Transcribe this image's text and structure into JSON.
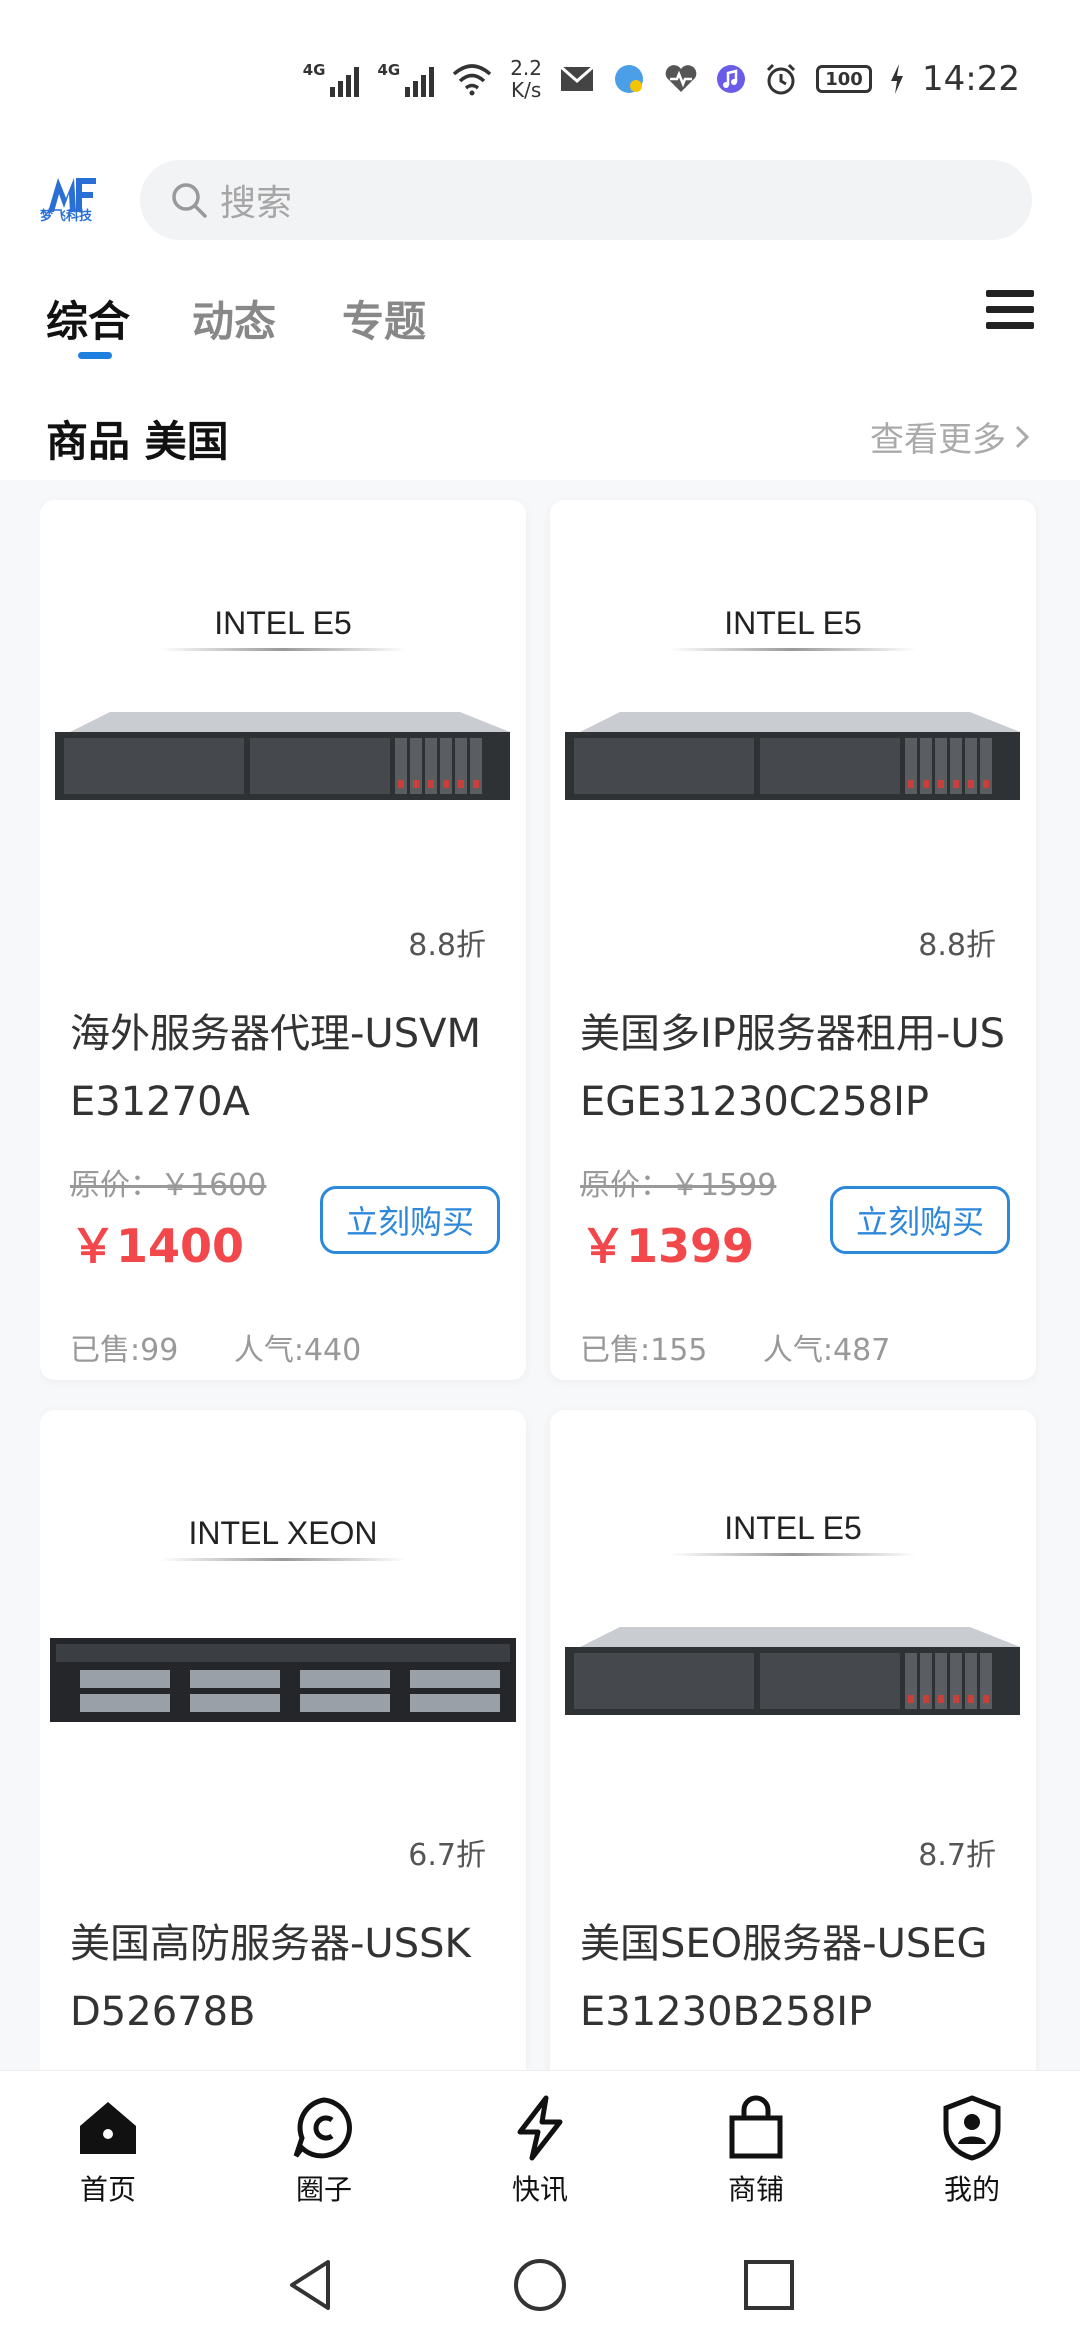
{
  "status_bar": {
    "net1": "4G",
    "net2": "4G",
    "speed_value": "2.2",
    "speed_unit": "K/s",
    "battery": "100",
    "time": "14:22"
  },
  "header": {
    "logo_text": "梦飞科技",
    "search_placeholder": "搜索"
  },
  "tabs": [
    {
      "label": "综合",
      "active": true
    },
    {
      "label": "动态",
      "active": false
    },
    {
      "label": "专题",
      "active": false
    }
  ],
  "section": {
    "title": "商品 美国",
    "more": "查看更多"
  },
  "products": [
    {
      "image_caption": "INTEL E5",
      "discount": "8.8折",
      "name": "海外服务器代理-USVME31270A",
      "original_price": "原价：￥1600",
      "price": "￥1400",
      "buy_label": "立刻购买",
      "sold": "已售:99",
      "popularity": "人气:440"
    },
    {
      "image_caption": "INTEL E5",
      "discount": "8.8折",
      "name": "美国多IP服务器租用-USEGE31230C258IP",
      "original_price": "原价：￥1599",
      "price": "￥1399",
      "buy_label": "立刻购买",
      "sold": "已售:155",
      "popularity": "人气:487"
    },
    {
      "image_caption": "INTEL XEON",
      "discount": "6.7折",
      "name": "美国高防服务器-USSKD52678B"
    },
    {
      "image_caption": "INTEL E5",
      "discount": "8.7折",
      "name": "美国SEO服务器-USEGE31230B258IP"
    }
  ],
  "bottom_nav": [
    {
      "label": "首页",
      "icon": "home-icon"
    },
    {
      "label": "圈子",
      "icon": "circle-icon"
    },
    {
      "label": "快讯",
      "icon": "lightning-icon"
    },
    {
      "label": "商铺",
      "icon": "shopping-bag-icon"
    },
    {
      "label": "我的",
      "icon": "user-shield-icon"
    }
  ],
  "colors": {
    "accent": "#1e7fe0",
    "price": "#f2474b",
    "buy_border": "#2d87db"
  }
}
